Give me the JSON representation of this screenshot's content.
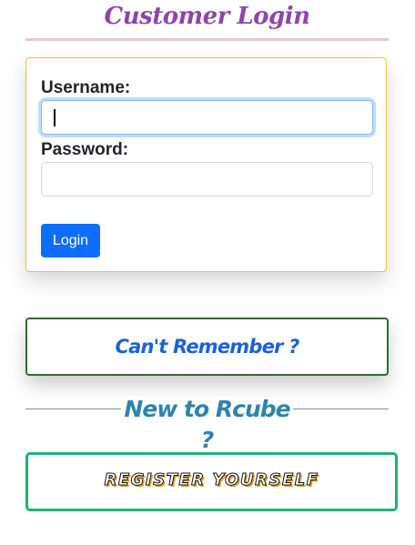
{
  "page": {
    "title": "Customer Login",
    "title_color": "#8e44ad"
  },
  "login_form": {
    "username_label": "Username:",
    "username_value": "",
    "password_label": "Password:",
    "password_value": "",
    "login_button": "Login",
    "button_color": "#0d6efd",
    "border_color": "#efc237"
  },
  "forgot": {
    "label": "Can't Remember ?",
    "color": "#1a62d8"
  },
  "new_user": {
    "heading": "New to Rcube ?",
    "color": "#2e84ad"
  },
  "register": {
    "label": "REGISTER YOURSELF",
    "border_color": "#19b574"
  }
}
